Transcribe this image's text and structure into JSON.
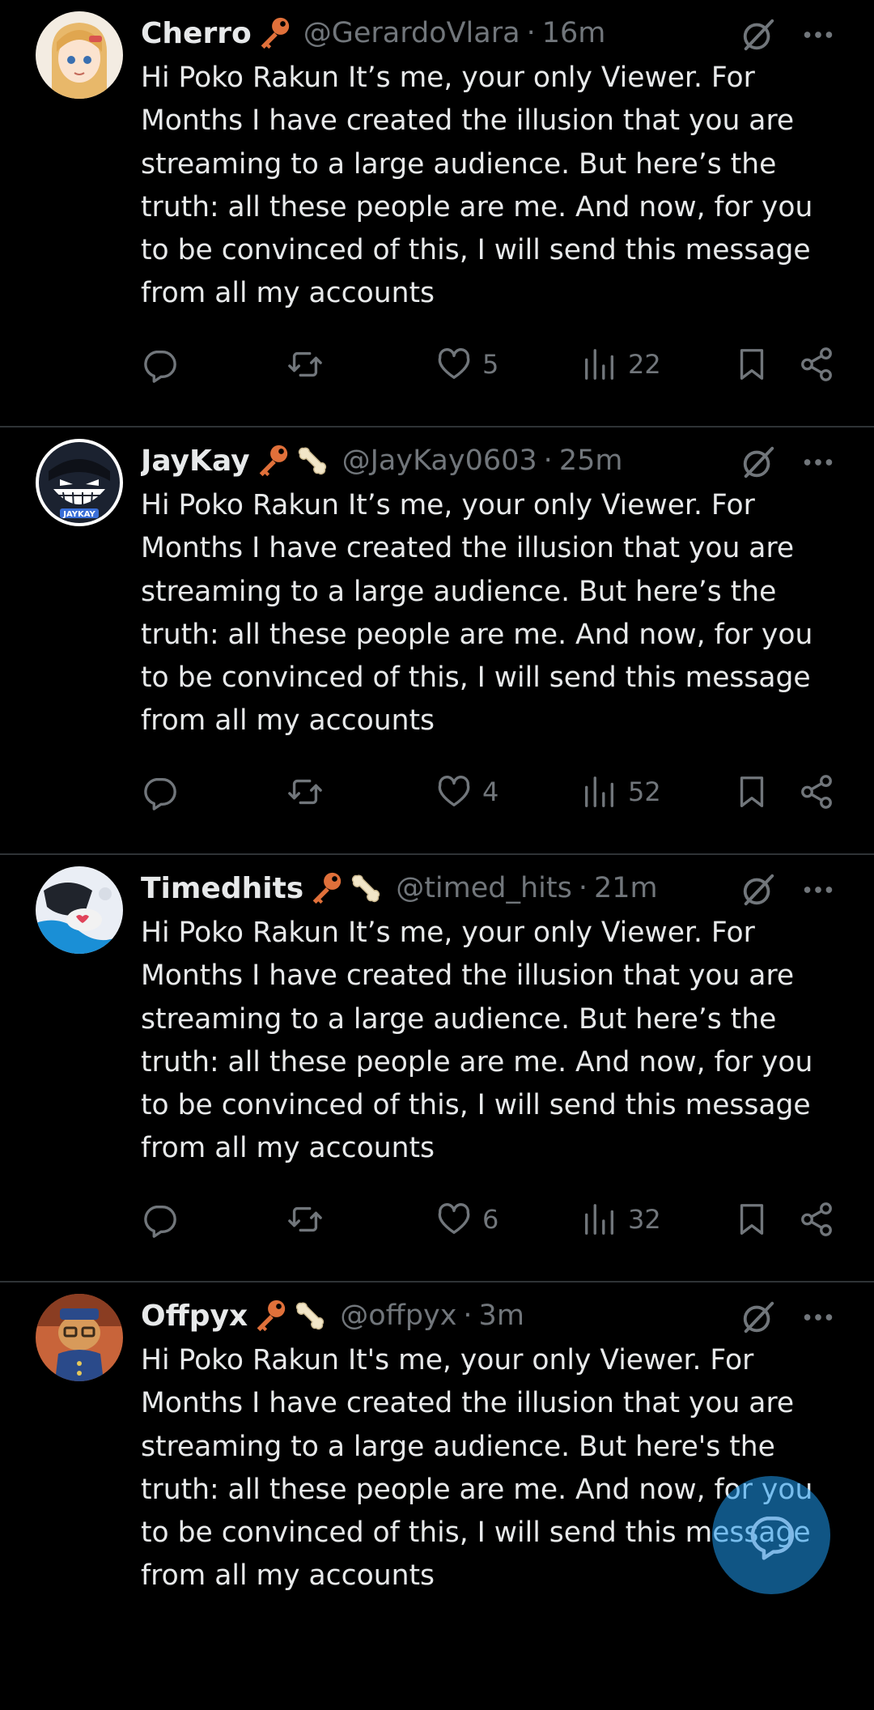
{
  "colors": {
    "background": "#000000",
    "text": "#e7e9ea",
    "secondary": "#71767b",
    "divider": "#2f3336",
    "accent": "#1d9bf0",
    "key_badge": "#e0703a",
    "bone_badge": "#f2e6c8"
  },
  "tweets": [
    {
      "display_name": "Cherro",
      "badges": [
        "key-icon"
      ],
      "handle": "@GerardoVlara",
      "separator": "·",
      "time": "16m",
      "text": "Hi Poko Rakun It’s me, your only Viewer. For Months I have created the illusion that you are streaming to a large audience. But here’s the truth: all these people are me. And now, for you to be convinced of this, I will send this message from all my accounts",
      "likes": "5",
      "views": "22"
    },
    {
      "display_name": "JayKay",
      "badges": [
        "key-icon",
        "bone-icon"
      ],
      "handle": "@JayKay0603",
      "separator": "·",
      "time": "25m",
      "text": "Hi Poko Rakun It’s me, your only Viewer. For Months I have created the illusion that you are streaming to a large audience. But here’s the truth: all these people are me. And now, for you to be convinced of this, I will send this message from all my accounts",
      "likes": "4",
      "views": "52"
    },
    {
      "display_name": "Timedhits",
      "badges": [
        "key-icon",
        "bone-icon"
      ],
      "handle": "@timed_hits",
      "separator": "·",
      "time": "21m",
      "text": "Hi Poko Rakun It’s me, your only Viewer. For Months I have created the illusion that you are streaming to a large audience. But here’s the truth: all these people are me. And now, for you to be convinced of this, I will send this message from all my accounts",
      "likes": "6",
      "views": "32"
    },
    {
      "display_name": "Offpyx",
      "badges": [
        "key-icon",
        "bone-icon"
      ],
      "handle": "@offpyx",
      "separator": "·",
      "time": "3m",
      "text": "Hi Poko Rakun It's me, your only Viewer. For Months I have created the illusion that you are streaming to a large audience. But here's the truth: all these people are me. And now, for you to be convinced of this, I will send this message from all my accounts",
      "likes": "",
      "views": ""
    }
  ],
  "avatar_text": {
    "jaykay": "JAYKAY"
  },
  "fab": {
    "icon": "compose-icon"
  }
}
